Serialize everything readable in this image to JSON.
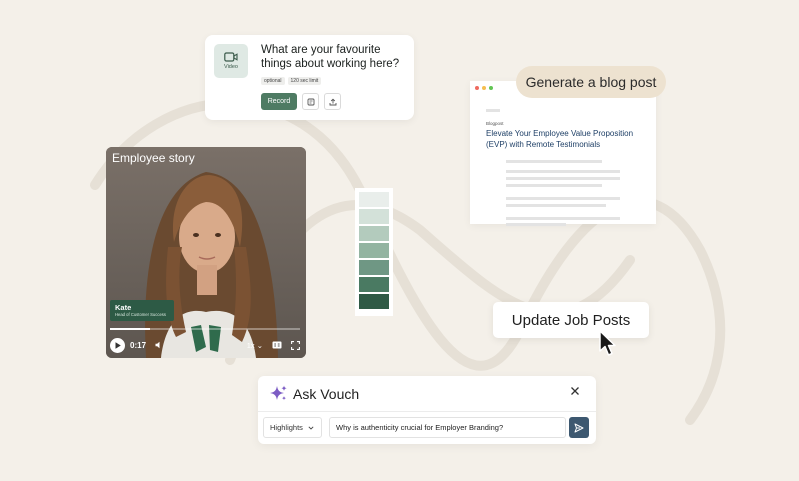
{
  "question_card": {
    "icon_label": "Video",
    "title": "What are your favourite things about working here?",
    "tags": [
      "optional",
      "120 sec limit"
    ],
    "record_label": "Record"
  },
  "video_card": {
    "title": "Employee story",
    "person_name": "Kate",
    "person_role": "Head of Customer Success",
    "time": "0:17",
    "speed": "1x",
    "progress": 0.21
  },
  "swatches": [
    "#e9eeeb",
    "#d3e1d9",
    "#b3cbbd",
    "#93b4a1",
    "#6f9784",
    "#4a7a62",
    "#2f5a45"
  ],
  "blog_card": {
    "chip_label": "Generate a blog post",
    "small_label": "Blogpost",
    "heading": "Elevate Your Employee Value Proposition (EVP) with Remote Testimonials"
  },
  "update_button": {
    "label": "Update Job Posts"
  },
  "ask_vouch": {
    "title": "Ask Vouch",
    "select_value": "Highlights",
    "input_value": "Why is authenticity crucial for Employer Branding?"
  },
  "colors": {
    "background": "#f4f0e9",
    "accent_green": "#4e7b63",
    "send_button": "#3d5870",
    "sparkle": "#7c5cc4"
  }
}
